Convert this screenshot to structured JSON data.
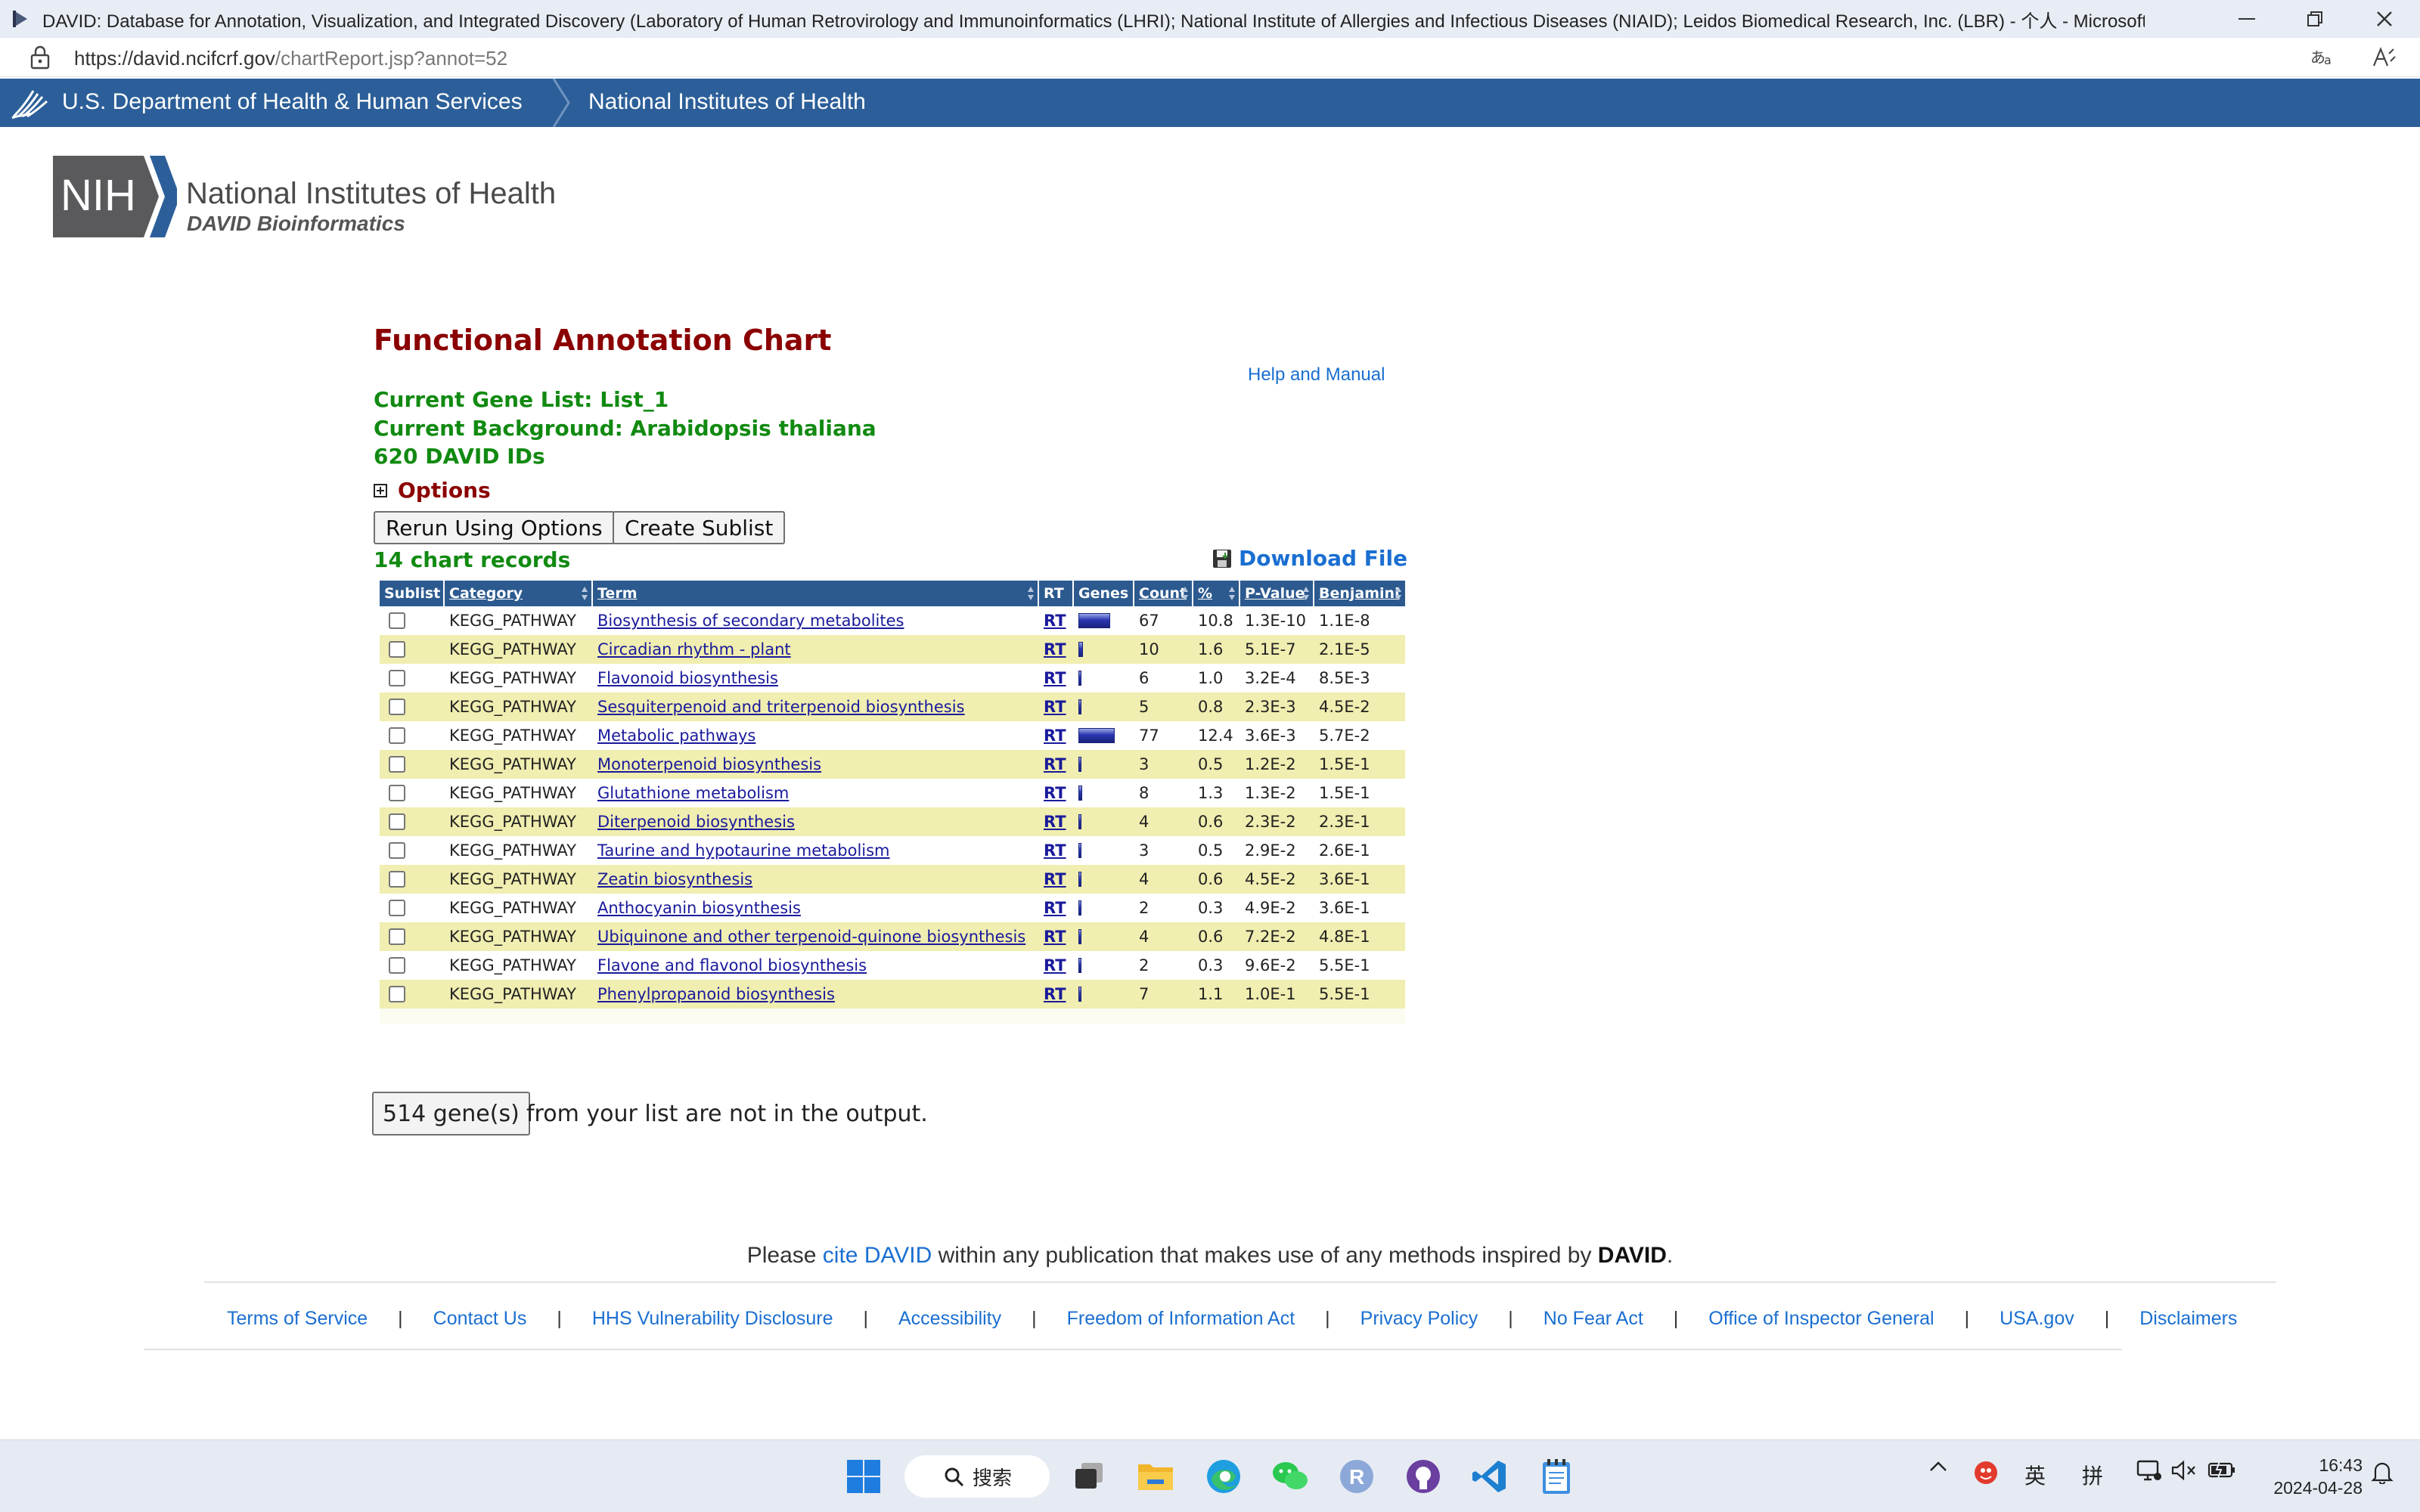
{
  "window": {
    "title": "DAVID: Database for Annotation, Visualization, and Integrated Discovery (Laboratory of Human Retrovirology and Immunoinformatics (LHRI); National Institute of Allergies and Infectious Diseases (NIAID); Leidos Biomedical Research, Inc. (LBR) - 个人 - Microsoft Edge"
  },
  "address": {
    "url_host": "https://david.ncifcrf.gov",
    "url_path": "/chartReport.jsp?annot=52"
  },
  "hhs_bar": {
    "hhs_label": "U.S. Department of Health & Human Services",
    "nih_label": "National Institutes of Health"
  },
  "logo": {
    "mark": "NIH",
    "name": "National Institutes of Health",
    "sub": "DAVID Bioinformatics"
  },
  "page": {
    "title": "Functional Annotation Chart",
    "help_link": "Help and Manual",
    "gene_list": "Current Gene List: List_1",
    "background": "Current Background: Arabidopsis thaliana",
    "david_ids": "620 DAVID IDs",
    "options_label": "Options",
    "options_toggle": "⊞",
    "rerun_button": "Rerun Using Options",
    "sublist_button": "Create Sublist",
    "records": "14 chart records",
    "download": "Download File"
  },
  "table": {
    "headers": {
      "sublist": "Sublist",
      "category": "Category",
      "term": "Term",
      "rt": "RT",
      "genes": "Genes",
      "count": "Count",
      "pct": "%",
      "pvalue": "P-Value",
      "benjamini": "Benjamini"
    },
    "rows": [
      {
        "category": "KEGG_PATHWAY",
        "term": "Biosynthesis of secondary metabolites",
        "rt": "RT",
        "count": "67",
        "pct": "10.8",
        "pvalue": "1.3E-10",
        "benjamini": "1.1E-8"
      },
      {
        "category": "KEGG_PATHWAY",
        "term": "Circadian rhythm - plant",
        "rt": "RT",
        "count": "10",
        "pct": "1.6",
        "pvalue": "5.1E-7",
        "benjamini": "2.1E-5"
      },
      {
        "category": "KEGG_PATHWAY",
        "term": "Flavonoid biosynthesis",
        "rt": "RT",
        "count": "6",
        "pct": "1.0",
        "pvalue": "3.2E-4",
        "benjamini": "8.5E-3"
      },
      {
        "category": "KEGG_PATHWAY",
        "term": "Sesquiterpenoid and triterpenoid biosynthesis",
        "rt": "RT",
        "count": "5",
        "pct": "0.8",
        "pvalue": "2.3E-3",
        "benjamini": "4.5E-2"
      },
      {
        "category": "KEGG_PATHWAY",
        "term": "Metabolic pathways",
        "rt": "RT",
        "count": "77",
        "pct": "12.4",
        "pvalue": "3.6E-3",
        "benjamini": "5.7E-2"
      },
      {
        "category": "KEGG_PATHWAY",
        "term": "Monoterpenoid biosynthesis",
        "rt": "RT",
        "count": "3",
        "pct": "0.5",
        "pvalue": "1.2E-2",
        "benjamini": "1.5E-1"
      },
      {
        "category": "KEGG_PATHWAY",
        "term": "Glutathione metabolism",
        "rt": "RT",
        "count": "8",
        "pct": "1.3",
        "pvalue": "1.3E-2",
        "benjamini": "1.5E-1"
      },
      {
        "category": "KEGG_PATHWAY",
        "term": "Diterpenoid biosynthesis",
        "rt": "RT",
        "count": "4",
        "pct": "0.6",
        "pvalue": "2.3E-2",
        "benjamini": "2.3E-1"
      },
      {
        "category": "KEGG_PATHWAY",
        "term": "Taurine and hypotaurine metabolism",
        "rt": "RT",
        "count": "3",
        "pct": "0.5",
        "pvalue": "2.9E-2",
        "benjamini": "2.6E-1"
      },
      {
        "category": "KEGG_PATHWAY",
        "term": "Zeatin biosynthesis",
        "rt": "RT",
        "count": "4",
        "pct": "0.6",
        "pvalue": "4.5E-2",
        "benjamini": "3.6E-1"
      },
      {
        "category": "KEGG_PATHWAY",
        "term": "Anthocyanin biosynthesis",
        "rt": "RT",
        "count": "2",
        "pct": "0.3",
        "pvalue": "4.9E-2",
        "benjamini": "3.6E-1"
      },
      {
        "category": "KEGG_PATHWAY",
        "term": "Ubiquinone and other terpenoid-quinone biosynthesis",
        "rt": "RT",
        "count": "4",
        "pct": "0.6",
        "pvalue": "7.2E-2",
        "benjamini": "4.8E-1"
      },
      {
        "category": "KEGG_PATHWAY",
        "term": "Flavone and flavonol biosynthesis",
        "rt": "RT",
        "count": "2",
        "pct": "0.3",
        "pvalue": "9.6E-2",
        "benjamini": "5.5E-1"
      },
      {
        "category": "KEGG_PATHWAY",
        "term": "Phenylpropanoid biosynthesis",
        "rt": "RT",
        "count": "7",
        "pct": "1.1",
        "pvalue": "1.0E-1",
        "benjamini": "5.5E-1"
      }
    ]
  },
  "genes_note": {
    "button": "514 gene(s)",
    "text": "from your list are not in the output."
  },
  "footer": {
    "cite_pre": "Please",
    "cite_link": "cite DAVID",
    "cite_mid": "within any publication that makes use of any methods inspired by",
    "cite_bold": "DAVID",
    "cite_end": ".",
    "links": [
      "Terms of Service",
      "Contact Us",
      "HHS Vulnerability Disclosure",
      "Accessibility",
      "Freedom of Information Act",
      "Privacy Policy",
      "No Fear Act",
      "Office of Inspector General",
      "USA.gov",
      "Disclaimers"
    ],
    "separator": "|"
  },
  "taskbar": {
    "search_label": "搜索",
    "tray_lang1": "英",
    "tray_lang2": "拼",
    "time": "16:43",
    "date": "2024-04-28"
  },
  "colors": {
    "hhs_bar": "#2c5f99",
    "table_header": "#2c5a8f",
    "row_alt": "#f0eeb0",
    "title_red": "#8b0000",
    "info_green": "#118a11",
    "link_blue": "#1a6fd1"
  },
  "icons": [
    "edge-app-icon",
    "minimize-icon",
    "restore-icon",
    "close-icon",
    "lock-icon",
    "read-aloud-icon",
    "font-icon",
    "hhs-eagle-icon",
    "plus-box-icon",
    "download-disk-icon",
    "windows-start-icon",
    "search-icon",
    "task-view-icon",
    "file-explorer-icon",
    "edge-icon",
    "wechat-icon",
    "r-icon",
    "github-icon",
    "vscode-icon",
    "notepad-icon",
    "chevron-up-icon",
    "app-tray-icon",
    "network-icon",
    "volume-muted-icon",
    "battery-icon",
    "notification-bell-icon"
  ]
}
